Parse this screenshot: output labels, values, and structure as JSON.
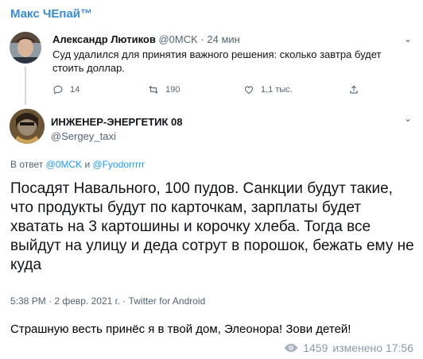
{
  "channel": {
    "title": "Макс ЧЕпай™"
  },
  "parent_tweet": {
    "author_name": "Александр Лютиков",
    "handle": "@0MCK",
    "separator": "·",
    "time_ago": "24 мин",
    "text": "Суд удалился для принятия важного решения: сколько завтра будет стоить доллар.",
    "replies": "14",
    "retweets": "190",
    "likes": "1,1 тыс.",
    "icons": [
      "reply-icon",
      "retweet-icon",
      "like-icon",
      "share-icon"
    ]
  },
  "reply_tweet": {
    "author_name": "ИНЖЕНЕР-ЭНЕРГЕТИК 08",
    "handle": "@Sergey_taxi",
    "reply_prefix": "В ответ",
    "reply_user1": "@0MCK",
    "reply_and": "и",
    "reply_user2": "@Fyodorrrrr",
    "text": "Посадят Навального, 100 пудов. Санкции будут такие, что продукты будут по карточкам, зарплаты будет хватать на 3 картошины и корочку хлеба. Тогда все выйдут на улицу и деда сотрут в порошок, бежать ему не куда",
    "timestamp": "5:38 PM · 2 февр. 2021 г. · Twitter for Android"
  },
  "post": {
    "caption": "Страшную весть принёс я в твой дом, Элеонора! Зови детей!",
    "views": "1459",
    "edited_label": "изменено 17:56"
  },
  "colors": {
    "accent": "#3a8bd2",
    "link": "#1d9bf0",
    "muted": "#536471"
  }
}
